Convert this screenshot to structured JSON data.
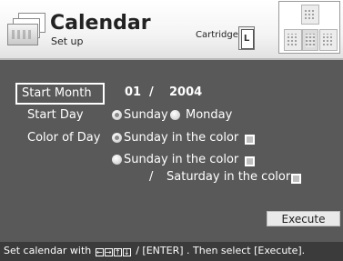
{
  "header": {
    "title": "Calendar",
    "subtitle": "Set up",
    "cartridge_label": "Cartridge",
    "cartridge_letter": "L",
    "icons": [
      "calendar-stack-icon",
      "cartridge-icon",
      "layout-preview"
    ]
  },
  "form": {
    "start_month": {
      "label": "Start Month",
      "month": "01",
      "separator": "/",
      "year": "2004"
    },
    "start_day": {
      "label": "Start Day",
      "options": [
        "Sunday",
        "Monday"
      ],
      "selected": "Sunday"
    },
    "color_of_day": {
      "label": "Color of Day",
      "option1": "Sunday in the color",
      "option2_part1": "Sunday in the color",
      "option2_sep": "/",
      "option2_part2": "Saturday in the color",
      "selected": "option1"
    }
  },
  "execute_label": "Execute",
  "footer": {
    "prefix": "Set calendar with",
    "arrow_keys": [
      "←",
      "→",
      "↑",
      "↓"
    ],
    "suffix": "/ [ENTER] . Then select [Execute]."
  },
  "colors": {
    "background": "#595959",
    "header_bg": "#f4f4f4",
    "footer_bg": "#3b3b3b",
    "text": "#ffffff"
  }
}
